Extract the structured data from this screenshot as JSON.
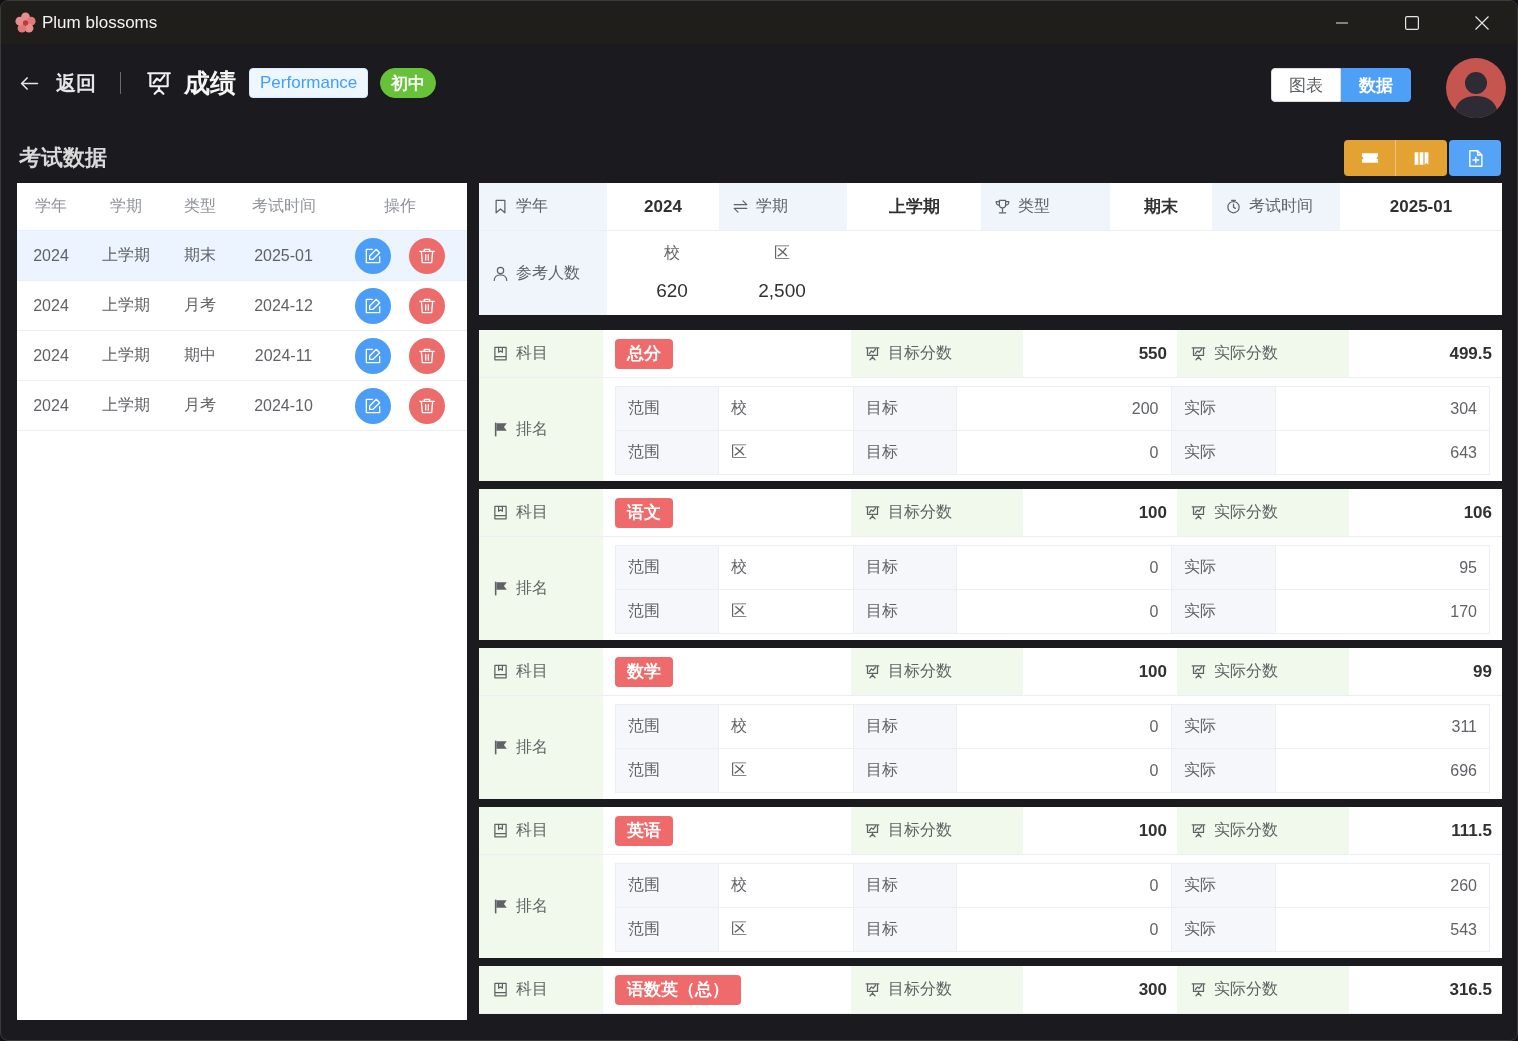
{
  "window": {
    "title": "Plum blossoms"
  },
  "header": {
    "back": "返回",
    "title": "成绩",
    "tags": [
      {
        "text": "Performance",
        "kind": "light",
        "color": "#409eff"
      },
      {
        "text": "初中",
        "kind": "filled",
        "color": "#67c23a"
      }
    ],
    "view_toggle": [
      {
        "label": "图表",
        "selected": false
      },
      {
        "label": "数据",
        "selected": true
      }
    ]
  },
  "section": {
    "title": "考试数据"
  },
  "exam_table": {
    "columns": [
      "学年",
      "学期",
      "类型",
      "考试时间",
      "操作"
    ],
    "rows": [
      {
        "cells": [
          "2024",
          "上学期",
          "期末",
          "2025-01"
        ],
        "selected": true
      },
      {
        "cells": [
          "2024",
          "上学期",
          "月考",
          "2024-12"
        ],
        "selected": false
      },
      {
        "cells": [
          "2024",
          "上学期",
          "期中",
          "2024-11"
        ],
        "selected": false
      },
      {
        "cells": [
          "2024",
          "上学期",
          "月考",
          "2024-10"
        ],
        "selected": false
      }
    ]
  },
  "exam_info": {
    "fields": [
      {
        "label": "学年",
        "value": "2024"
      },
      {
        "label": "学期",
        "value": "上学期"
      },
      {
        "label": "类型",
        "value": "期末"
      },
      {
        "label": "考试时间",
        "value": "2025-01"
      }
    ],
    "participants": {
      "label": "参考人数",
      "groups": [
        {
          "scope": "校",
          "count": "620"
        },
        {
          "scope": "区",
          "count": "2,500"
        }
      ]
    }
  },
  "subjects": [
    {
      "subject_label": "科目",
      "subject": "总分",
      "target_label": "目标分数",
      "target": "550",
      "actual_label": "实际分数",
      "actual": "499.5",
      "rank_label": "排名",
      "ranks": [
        {
          "scope_label": "范围",
          "scope": "校",
          "target_label": "目标",
          "target": "200",
          "actual_label": "实际",
          "actual": "304"
        },
        {
          "scope_label": "范围",
          "scope": "区",
          "target_label": "目标",
          "target": "0",
          "actual_label": "实际",
          "actual": "643"
        }
      ]
    },
    {
      "subject_label": "科目",
      "subject": "语文",
      "target_label": "目标分数",
      "target": "100",
      "actual_label": "实际分数",
      "actual": "106",
      "rank_label": "排名",
      "ranks": [
        {
          "scope_label": "范围",
          "scope": "校",
          "target_label": "目标",
          "target": "0",
          "actual_label": "实际",
          "actual": "95"
        },
        {
          "scope_label": "范围",
          "scope": "区",
          "target_label": "目标",
          "target": "0",
          "actual_label": "实际",
          "actual": "170"
        }
      ]
    },
    {
      "subject_label": "科目",
      "subject": "数学",
      "target_label": "目标分数",
      "target": "100",
      "actual_label": "实际分数",
      "actual": "99",
      "rank_label": "排名",
      "ranks": [
        {
          "scope_label": "范围",
          "scope": "校",
          "target_label": "目标",
          "target": "0",
          "actual_label": "实际",
          "actual": "311"
        },
        {
          "scope_label": "范围",
          "scope": "区",
          "target_label": "目标",
          "target": "0",
          "actual_label": "实际",
          "actual": "696"
        }
      ]
    },
    {
      "subject_label": "科目",
      "subject": "英语",
      "target_label": "目标分数",
      "target": "100",
      "actual_label": "实际分数",
      "actual": "111.5",
      "rank_label": "排名",
      "ranks": [
        {
          "scope_label": "范围",
          "scope": "校",
          "target_label": "目标",
          "target": "0",
          "actual_label": "实际",
          "actual": "260"
        },
        {
          "scope_label": "范围",
          "scope": "区",
          "target_label": "目标",
          "target": "0",
          "actual_label": "实际",
          "actual": "543"
        }
      ]
    },
    {
      "subject_label": "科目",
      "subject": "语数英（总）",
      "target_label": "目标分数",
      "target": "300",
      "actual_label": "实际分数",
      "actual": "316.5"
    }
  ]
}
